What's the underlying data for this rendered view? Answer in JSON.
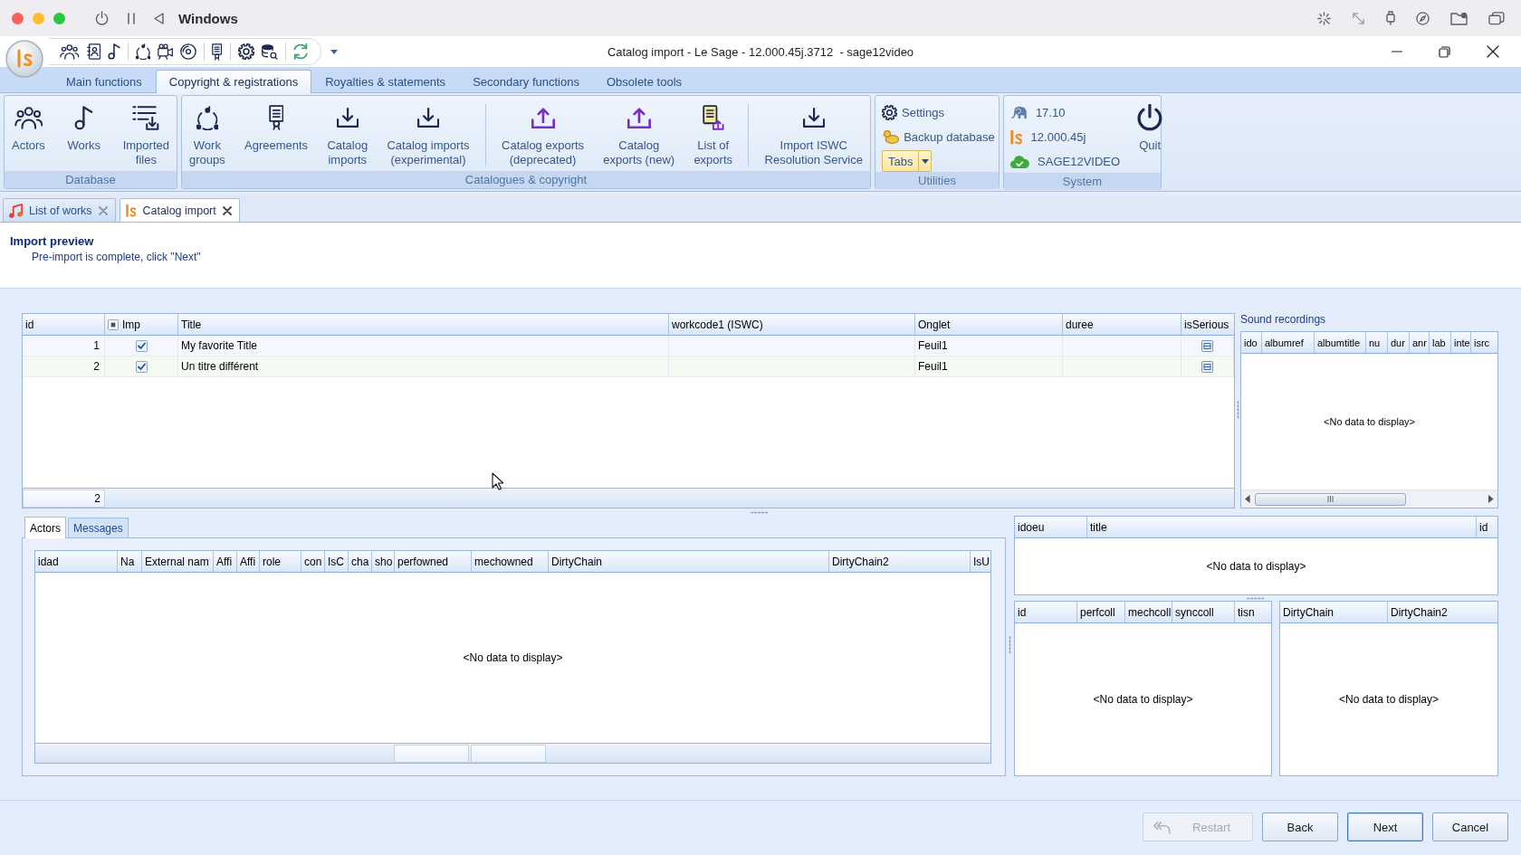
{
  "mac_menubar": {
    "title": "Windows"
  },
  "window": {
    "title": "Catalog import - Le Sage - 12.000.45j.3712  - sage12video"
  },
  "ribbon": {
    "tabs": [
      {
        "label": "Main functions",
        "selected": false
      },
      {
        "label": "Copyright & registrations",
        "selected": true
      },
      {
        "label": "Royalties & statements",
        "selected": false
      },
      {
        "label": "Secondary functions",
        "selected": false
      },
      {
        "label": "Obsolete tools",
        "selected": false
      }
    ],
    "groups": [
      {
        "label": "Database",
        "items": [
          {
            "kind": "large",
            "label": "Actors"
          },
          {
            "kind": "large",
            "label": "Works"
          },
          {
            "kind": "large",
            "label": "Imported\nfiles"
          }
        ]
      },
      {
        "label": "Catalogues & copyright",
        "items": [
          {
            "kind": "large",
            "label": "Work\ngroups"
          },
          {
            "kind": "large",
            "label": "Agreements"
          },
          {
            "kind": "large",
            "label": "Catalog\nimports"
          },
          {
            "kind": "large",
            "label": "Catalog imports\n(experimental)"
          },
          {
            "kind": "separator"
          },
          {
            "kind": "large",
            "label": "Catalog exports\n(deprecated)"
          },
          {
            "kind": "large",
            "label": "Catalog\nexports (new)"
          },
          {
            "kind": "large",
            "label": "List of\nexports"
          },
          {
            "kind": "separator"
          },
          {
            "kind": "large",
            "label": "Import ISWC\nResolution Service"
          }
        ]
      },
      {
        "label": "Utilities",
        "items": [
          {
            "kind": "stack",
            "items": [
              {
                "kind": "small",
                "label": "Settings"
              },
              {
                "kind": "small",
                "label": "Backup database"
              },
              {
                "kind": "dropdown",
                "label": "Tabs"
              }
            ]
          }
        ]
      },
      {
        "label": "System",
        "items": [
          {
            "kind": "stack",
            "items": [
              {
                "kind": "info",
                "label": "17.10"
              },
              {
                "kind": "info",
                "label": "12.000.45j"
              },
              {
                "kind": "info",
                "label": "SAGE12VIDEO"
              }
            ]
          },
          {
            "kind": "separator"
          },
          {
            "kind": "large",
            "label": "Quit"
          }
        ]
      }
    ]
  },
  "doc_tabs": [
    {
      "label": "List of works",
      "selected": false
    },
    {
      "label": "Catalog import",
      "selected": true
    }
  ],
  "import_preview": {
    "title": "Import preview",
    "subtitle": "Pre-import is complete, click \"Next\""
  },
  "works_grid": {
    "columns": [
      {
        "label": "id",
        "kind": "number"
      },
      {
        "label": "Imp",
        "kind": "check",
        "indeterminate": true
      },
      {
        "label": "Title",
        "kind": "text"
      },
      {
        "label": "workcode1 (ISWC)",
        "kind": "text"
      },
      {
        "label": "Onglet",
        "kind": "text"
      },
      {
        "label": "duree",
        "kind": "text"
      },
      {
        "label": "isSerious",
        "kind": "check"
      }
    ],
    "rows": [
      {
        "cells": [
          {
            "text": "1"
          },
          {
            "checked": true
          },
          {
            "text": "My favorite Title"
          },
          {},
          {
            "text": "Feuil1"
          },
          {},
          {
            "checked": false,
            "indeterminate": true
          }
        ]
      },
      {
        "cells": [
          {
            "text": "2"
          },
          {
            "checked": true
          },
          {
            "text": "Un titre différent"
          },
          {},
          {
            "text": "Feuil1"
          },
          {},
          {
            "checked": false,
            "indeterminate": true
          }
        ]
      }
    ],
    "footer": "2"
  },
  "sound_recordings": {
    "label": "Sound recordings",
    "columns": [
      "ido",
      "albumref",
      "albumtitle",
      "nu",
      "dur",
      "anr",
      "lab",
      "inte",
      "isrc"
    ],
    "empty_text": "<No data to display>"
  },
  "detail_tabs": {
    "tabs": [
      {
        "label": "Actors",
        "selected": true
      },
      {
        "label": "Messages",
        "selected": false
      }
    ],
    "grid": {
      "columns": [
        "idad",
        "Na",
        "External nam",
        "Affi",
        "Affi",
        "role",
        "con",
        "IsC",
        "cha",
        "sho",
        "perfowned",
        "mechowned",
        "DirtyChain",
        "DirtyChain2",
        "IsU"
      ],
      "empty_text": "<No data to display>"
    }
  },
  "detail_grids": [
    {
      "columns": [
        "idoeu",
        "title",
        "id"
      ],
      "empty_text": "<No data to display>"
    },
    {
      "columns": [
        "id",
        "perfcoll",
        "mechcoll",
        "synccoll",
        "tisn"
      ],
      "empty_text": "<No data to display>"
    },
    {
      "columns": [
        "DirtyChain",
        "DirtyChain2"
      ],
      "empty_text": "<No data to display>"
    }
  ],
  "buttons": [
    {
      "label": "Restart",
      "disabled": true,
      "default": false
    },
    {
      "label": "Back",
      "disabled": false,
      "default": false
    },
    {
      "label": "Next",
      "disabled": false,
      "default": true
    },
    {
      "label": "Cancel",
      "disabled": false,
      "default": false
    }
  ]
}
